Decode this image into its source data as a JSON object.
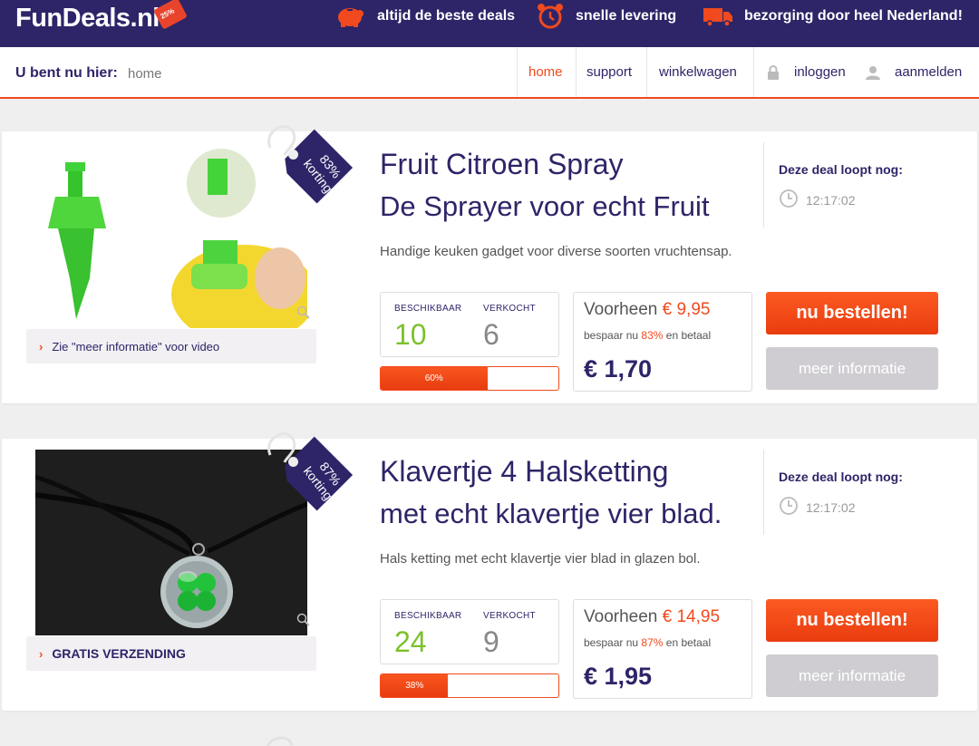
{
  "header": {
    "logo": "FunDeals.nl",
    "logo_badge": "25%",
    "usps": [
      "altijd de beste deals",
      "snelle levering",
      "bezorging door heel Nederland!"
    ]
  },
  "nav": {
    "breadcrumb_label": "U bent nu hier:",
    "breadcrumb_home": "home",
    "items": [
      "home",
      "support",
      "winkelwagen",
      "inloggen",
      "aanmelden"
    ]
  },
  "deals": [
    {
      "title": "Fruit Citroen Spray",
      "subtitle": "De Sprayer voor echt Fruit",
      "description": "Handige keuken gadget voor diverse soorten vruchtensap.",
      "discount_tag": "83%\nkorting",
      "timer_label": "Deze deal loopt nog:",
      "timer": "12:17:02",
      "available_label": "BESCHIKBAAR",
      "available": "10",
      "sold_label": "VERKOCHT",
      "sold": "6",
      "progress_label": "60%",
      "progress": 0.6,
      "was_label": "Voorheen",
      "was_price": "€ 9,95",
      "save_prefix": "bespaar nu",
      "save_pct": "83%",
      "save_suffix": "en betaal",
      "price": "€ 1,70",
      "order_button": "nu bestellen!",
      "more_button": "meer informatie",
      "info_bar": "Zie \"meer informatie\" voor video"
    },
    {
      "title": "Klavertje 4 Halsketting",
      "subtitle": "met echt klavertje vier blad.",
      "description": "Hals ketting met echt klavertje vier blad in glazen bol.",
      "discount_tag": "87%\nkorting",
      "timer_label": "Deze deal loopt nog:",
      "timer": "12:17:02",
      "available_label": "BESCHIKBAAR",
      "available": "24",
      "sold_label": "VERKOCHT",
      "sold": "9",
      "progress_label": "38%",
      "progress": 0.38,
      "was_label": "Voorheen",
      "was_price": "€ 14,95",
      "save_prefix": "bespaar nu",
      "save_pct": "87%",
      "save_suffix": "en betaal",
      "price": "€ 1,95",
      "order_button": "nu bestellen!",
      "more_button": "meer informatie",
      "info_bar": "GRATIS VERZENDING"
    }
  ],
  "colors": {
    "brand": "#2d2568",
    "accent": "#f04a1e",
    "green": "#7cc12d"
  }
}
